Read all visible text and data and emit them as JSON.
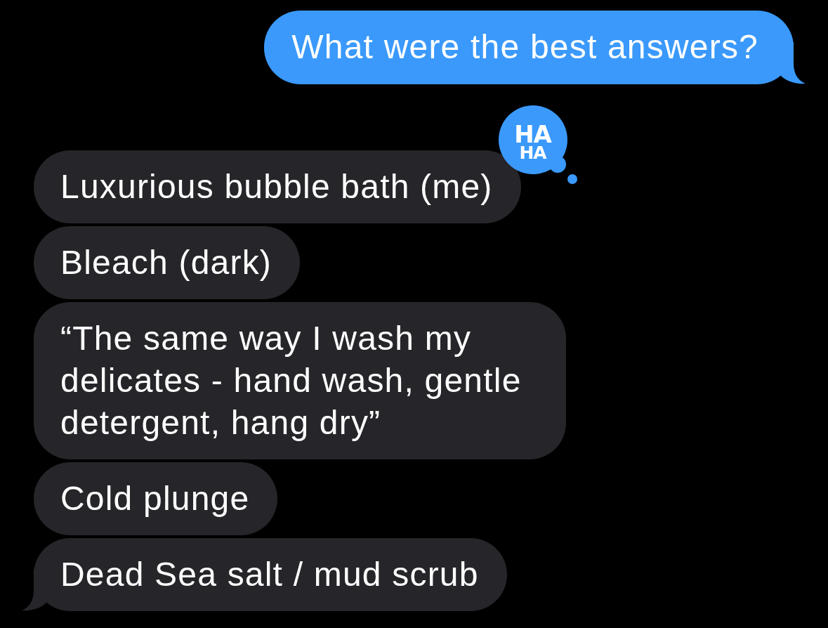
{
  "messages": [
    {
      "kind": "outgoing",
      "text": "What were the best answers?",
      "tail": true
    },
    {
      "kind": "incoming",
      "text": "Luxurious bubble bath (me)",
      "tail": false,
      "reaction": {
        "lines": [
          "HA",
          "HA"
        ]
      }
    },
    {
      "kind": "incoming",
      "text": "Bleach (dark)",
      "tail": false
    },
    {
      "kind": "incoming",
      "text": "“The same way I wash my delicates - hand wash, gentle detergent, hang dry”",
      "tail": false
    },
    {
      "kind": "incoming",
      "text": "Cold plunge",
      "tail": false
    },
    {
      "kind": "incoming",
      "text": "Dead Sea salt / mud scrub",
      "tail": true
    }
  ]
}
